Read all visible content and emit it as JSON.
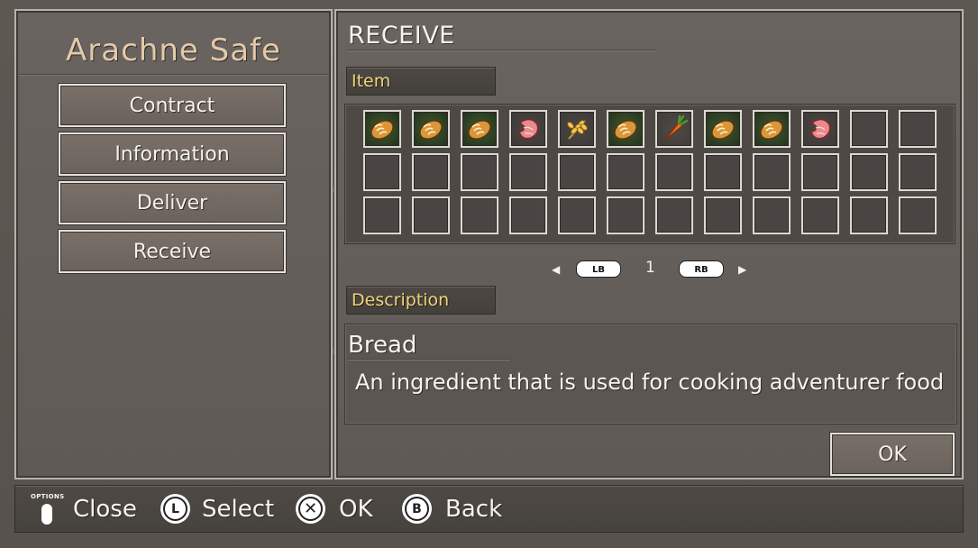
{
  "left_panel": {
    "title": "Arachne Safe",
    "menu": [
      {
        "label": "Contract"
      },
      {
        "label": "Information"
      },
      {
        "label": "Deliver"
      },
      {
        "label": "Receive"
      }
    ]
  },
  "right_panel": {
    "heading": "RECEIVE",
    "item_label": "Item",
    "inventory": {
      "rows": 3,
      "columns": 12,
      "items": [
        {
          "name": "bread-icon"
        },
        {
          "name": "bread-icon"
        },
        {
          "name": "bread-icon"
        },
        {
          "name": "meat-icon"
        },
        {
          "name": "wheat-icon"
        },
        {
          "name": "bread-icon"
        },
        {
          "name": "carrot-icon"
        },
        {
          "name": "bread-icon"
        },
        {
          "name": "bread-icon"
        },
        {
          "name": "meat-icon"
        }
      ]
    },
    "pager": {
      "prev_button": "LB",
      "page": "1",
      "next_button": "RB"
    },
    "description_label": "Description",
    "description": {
      "name": "Bread",
      "text": "An ingredient that is used for cooking adventurer food"
    },
    "ok_label": "OK"
  },
  "bottom_bar": {
    "options_label": "OPTIONS",
    "hints": [
      {
        "button": "options",
        "label": "Close"
      },
      {
        "button": "L",
        "label": "Select"
      },
      {
        "button": "✕",
        "label": "OK"
      },
      {
        "button": "B",
        "label": "Back"
      }
    ]
  },
  "colors": {
    "title_accent": "#e3c9a9",
    "label_accent": "#f0d47a",
    "panel_bg": "#655f5b",
    "slot_border": "#dcd8d2"
  }
}
